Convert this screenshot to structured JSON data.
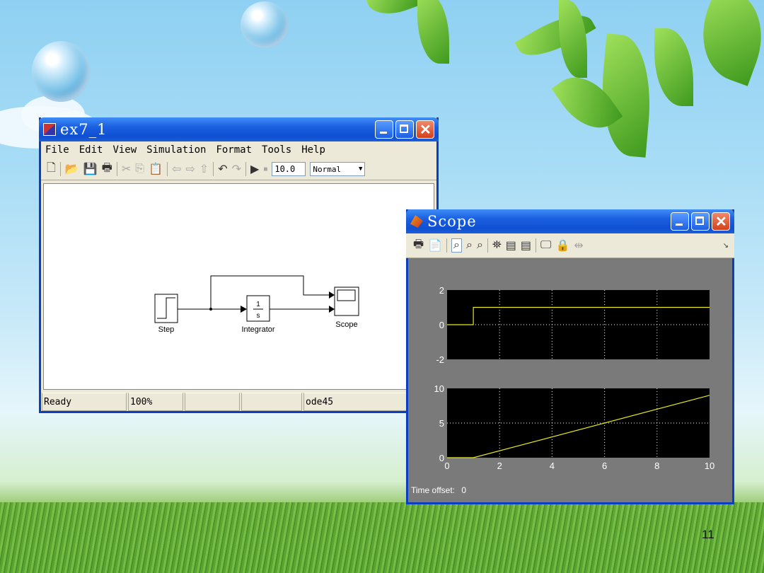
{
  "slide": {
    "page_number": "11"
  },
  "simulink": {
    "title": "ex7_1",
    "menu": [
      "File",
      "Edit",
      "View",
      "Simulation",
      "Format",
      "Tools",
      "Help"
    ],
    "stop_time": "10.0",
    "sim_mode": "Normal",
    "blocks": {
      "step": "Step",
      "integrator": "Integrator",
      "integrator_num": "1",
      "integrator_den": "s",
      "scope": "Scope"
    },
    "status": {
      "ready": "Ready",
      "zoom": "100%",
      "solver": "ode45"
    }
  },
  "scope": {
    "title": "Scope",
    "time_offset_label": "Time offset:",
    "time_offset_value": "0",
    "colors": {
      "background": "#7a7a7a",
      "plot": "#000000",
      "trace": "#e8e81a",
      "grid": "#ffffff"
    }
  },
  "chart_data": [
    {
      "type": "line",
      "x": [
        0,
        1,
        1,
        10
      ],
      "series": [
        {
          "values": [
            0,
            0,
            1,
            1
          ]
        }
      ],
      "yticks": [
        "2",
        "0",
        "-2"
      ],
      "ylim": [
        -2,
        2
      ],
      "xlim": [
        0,
        10
      ],
      "grid": true
    },
    {
      "type": "line",
      "x": [
        0,
        1,
        10
      ],
      "series": [
        {
          "values": [
            0,
            0,
            9
          ]
        }
      ],
      "yticks": [
        "10",
        "5",
        "0"
      ],
      "xticks": [
        "0",
        "2",
        "4",
        "6",
        "8",
        "10"
      ],
      "ylim": [
        0,
        10
      ],
      "xlim": [
        0,
        10
      ],
      "grid": true
    }
  ]
}
